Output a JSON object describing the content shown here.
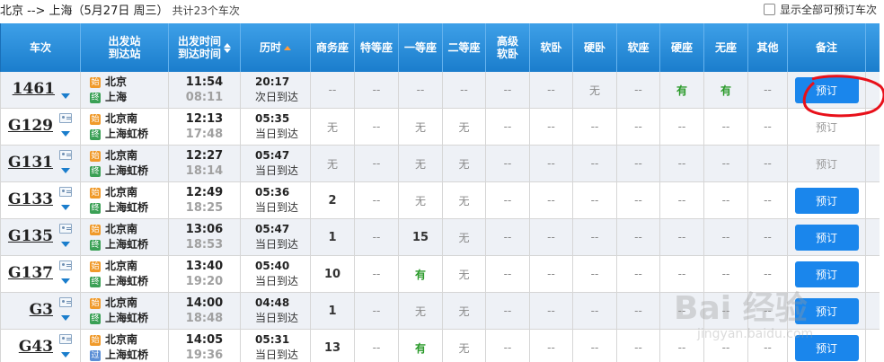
{
  "header": {
    "route": "北京 --> 上海（5月27日  周三）",
    "total": "共计23个车次",
    "show_all": "显示全部可预订车次"
  },
  "columns": {
    "train": "车次",
    "station_1": "出发站",
    "station_2": "到达站",
    "time_1": "出发时间",
    "time_2": "到达时间",
    "duration": "历时",
    "business": "商务座",
    "premium": "特等座",
    "first": "一等座",
    "second": "二等座",
    "soft_sleeper_hi_1": "高级",
    "soft_sleeper_hi_2": "软卧",
    "soft_sleeper": "软卧",
    "hard_sleeper": "硬卧",
    "soft_seat": "软座",
    "hard_seat": "硬座",
    "no_seat": "无座",
    "other": "其他",
    "remark": "备注"
  },
  "badges": {
    "start": "始",
    "end": "终",
    "pass": "过"
  },
  "rows": [
    {
      "train": "1461",
      "from": "北京",
      "to": "上海",
      "dep": "11:54",
      "arr": "08:11",
      "duration": "20:17",
      "arrive_day": "次日到达",
      "seats": [
        "--",
        "--",
        "--",
        "--",
        "--",
        "--",
        "无",
        "--",
        "有",
        "有",
        "--"
      ],
      "book": "预订",
      "bookable": true
    },
    {
      "train": "G129",
      "from": "北京南",
      "to": "上海虹桥",
      "dep": "12:13",
      "arr": "17:48",
      "duration": "05:35",
      "arrive_day": "当日到达",
      "seats": [
        "无",
        "--",
        "无",
        "无",
        "--",
        "--",
        "--",
        "--",
        "--",
        "--",
        "--"
      ],
      "book": "预订",
      "bookable": false
    },
    {
      "train": "G131",
      "from": "北京南",
      "to": "上海虹桥",
      "dep": "12:27",
      "arr": "18:14",
      "duration": "05:47",
      "arrive_day": "当日到达",
      "seats": [
        "无",
        "--",
        "无",
        "无",
        "--",
        "--",
        "--",
        "--",
        "--",
        "--",
        "--"
      ],
      "book": "预订",
      "bookable": false
    },
    {
      "train": "G133",
      "from": "北京南",
      "to": "上海虹桥",
      "dep": "12:49",
      "arr": "18:25",
      "duration": "05:36",
      "arrive_day": "当日到达",
      "seats": [
        "2",
        "--",
        "无",
        "无",
        "--",
        "--",
        "--",
        "--",
        "--",
        "--",
        "--"
      ],
      "book": "预订",
      "bookable": true
    },
    {
      "train": "G135",
      "from": "北京南",
      "to": "上海虹桥",
      "dep": "13:06",
      "arr": "18:53",
      "duration": "05:47",
      "arrive_day": "当日到达",
      "seats": [
        "1",
        "--",
        "15",
        "无",
        "--",
        "--",
        "--",
        "--",
        "--",
        "--",
        "--"
      ],
      "book": "预订",
      "bookable": true
    },
    {
      "train": "G137",
      "from": "北京南",
      "to": "上海虹桥",
      "dep": "13:40",
      "arr": "19:20",
      "duration": "05:40",
      "arrive_day": "当日到达",
      "seats": [
        "10",
        "--",
        "有",
        "无",
        "--",
        "--",
        "--",
        "--",
        "--",
        "--",
        "--"
      ],
      "book": "预订",
      "bookable": true
    },
    {
      "train": "G3",
      "from": "北京南",
      "to": "上海虹桥",
      "dep": "14:00",
      "arr": "18:48",
      "duration": "04:48",
      "arrive_day": "当日到达",
      "seats": [
        "1",
        "--",
        "无",
        "无",
        "--",
        "--",
        "--",
        "--",
        "--",
        "--",
        "--"
      ],
      "book": "预订",
      "bookable": true
    },
    {
      "train": "G43",
      "from": "北京南",
      "to": "上海虹桥",
      "dep": "14:05",
      "arr": "19:36",
      "duration": "05:31",
      "arrive_day": "当日到达",
      "seats": [
        "13",
        "--",
        "有",
        "无",
        "--",
        "--",
        "--",
        "--",
        "--",
        "--",
        "--"
      ],
      "book": "预订",
      "bookable": true
    }
  ],
  "watermark": {
    "main": "Bai 经验",
    "sub": "jingyan.baidu.com"
  },
  "colors": {
    "header_blue": "#1a7dcc",
    "button_blue": "#1a86ec",
    "available_green": "#2a9a2a",
    "annotation_red": "#e8101a"
  }
}
